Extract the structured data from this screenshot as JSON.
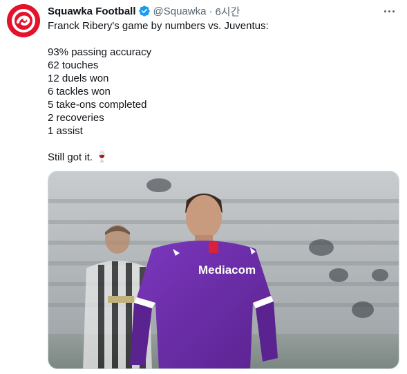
{
  "tweet": {
    "author": {
      "display_name": "Squawka Football",
      "handle": "@Squawka",
      "verified": true,
      "avatar_icon": "squawka-logo-icon",
      "avatar_color": "#e4122b"
    },
    "separator": "·",
    "timestamp": "6시간",
    "more_icon": "more-horizontal-icon",
    "lines": [
      "Franck Ribery's game by numbers vs. Juventus:",
      "",
      "93% passing accuracy",
      "62 touches",
      "12 duels won",
      "6 tackles won",
      "5 take-ons completed",
      "2 recoveries",
      "1 assist",
      "",
      "Still got it. 🍷"
    ],
    "media": {
      "kind": "photo",
      "jersey_sponsor": "Mediacom",
      "jersey_color": "#6a2ca6"
    }
  },
  "colors": {
    "text_primary": "#0f1419",
    "text_secondary": "#536471",
    "verified_blue": "#1d9bf0",
    "border": "#cfd9de"
  }
}
